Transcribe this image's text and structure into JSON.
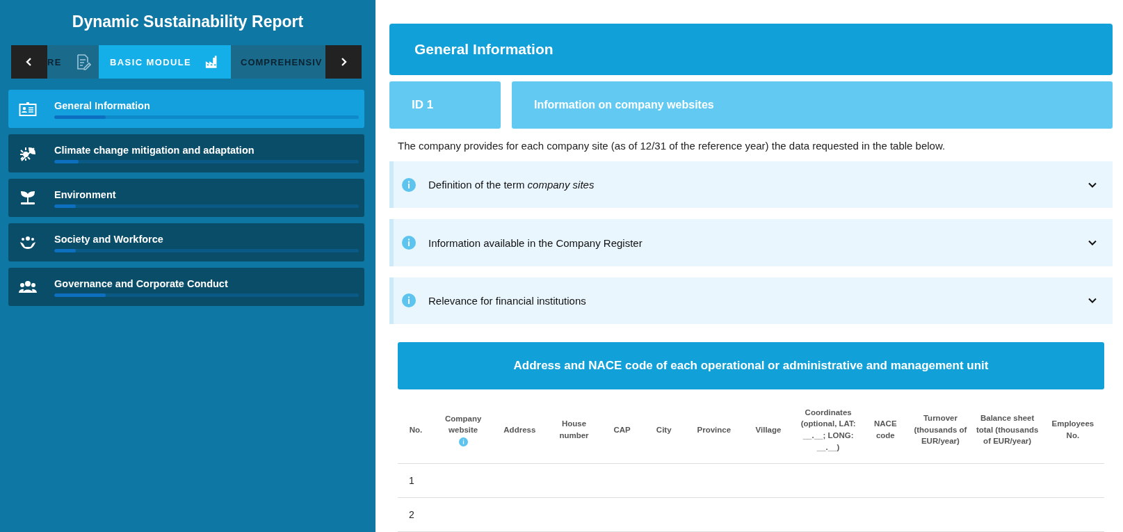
{
  "sidebar": {
    "title": "Dynamic Sustainability Report",
    "modules": [
      {
        "label": "RE",
        "selected": false
      },
      {
        "label": "BASIC MODULE",
        "selected": true
      },
      {
        "label": "COMPREHENSIV",
        "selected": false
      }
    ],
    "items": [
      {
        "label": "General Information",
        "selected": true,
        "level": 0.17
      },
      {
        "label": "Climate change mitigation and adaptation",
        "selected": false,
        "level": 0.08
      },
      {
        "label": "Environment",
        "selected": false,
        "level": 0.07
      },
      {
        "label": "Society and Workforce",
        "selected": false,
        "level": 0.07
      },
      {
        "label": "Governance and Corporate Conduct",
        "selected": false,
        "level": 0.17
      }
    ]
  },
  "section": {
    "title": "General Information",
    "id": "ID 1",
    "subtitle": "Information on company websites",
    "description": "The company provides for each company site (as of 12/31 of the reference year) the data requested in the table below.",
    "accordions": [
      {
        "title": "Definition of the term *company sites*",
        "expanded": false
      },
      {
        "title": "Information available in the Company Register",
        "expanded": false
      },
      {
        "title": "Relevance for financial institutions",
        "expanded": false
      }
    ]
  },
  "table": {
    "title": "Address and NACE code of each operational or administrative and management unit",
    "columns": [
      {
        "label": "No.",
        "info": false
      },
      {
        "label": "Company website",
        "info": true
      },
      {
        "label": "Address",
        "info": false
      },
      {
        "label": "House number",
        "info": false
      },
      {
        "label": "CAP",
        "info": false
      },
      {
        "label": "City",
        "info": false
      },
      {
        "label": "Province",
        "info": false
      },
      {
        "label": "Village",
        "info": false
      },
      {
        "label": "Coordinates (optional, LAT: __.__; LONG: __.__)",
        "info": false
      },
      {
        "label": "NACE code",
        "info": false
      },
      {
        "label": "Turnover (thousands of EUR/year)",
        "info": false
      },
      {
        "label": "Balance sheet total (thousands of EUR/year)",
        "info": false
      },
      {
        "label": "Employees No.",
        "info": false
      }
    ],
    "rows": [
      {
        "no": "1"
      },
      {
        "no": "2"
      }
    ]
  }
}
